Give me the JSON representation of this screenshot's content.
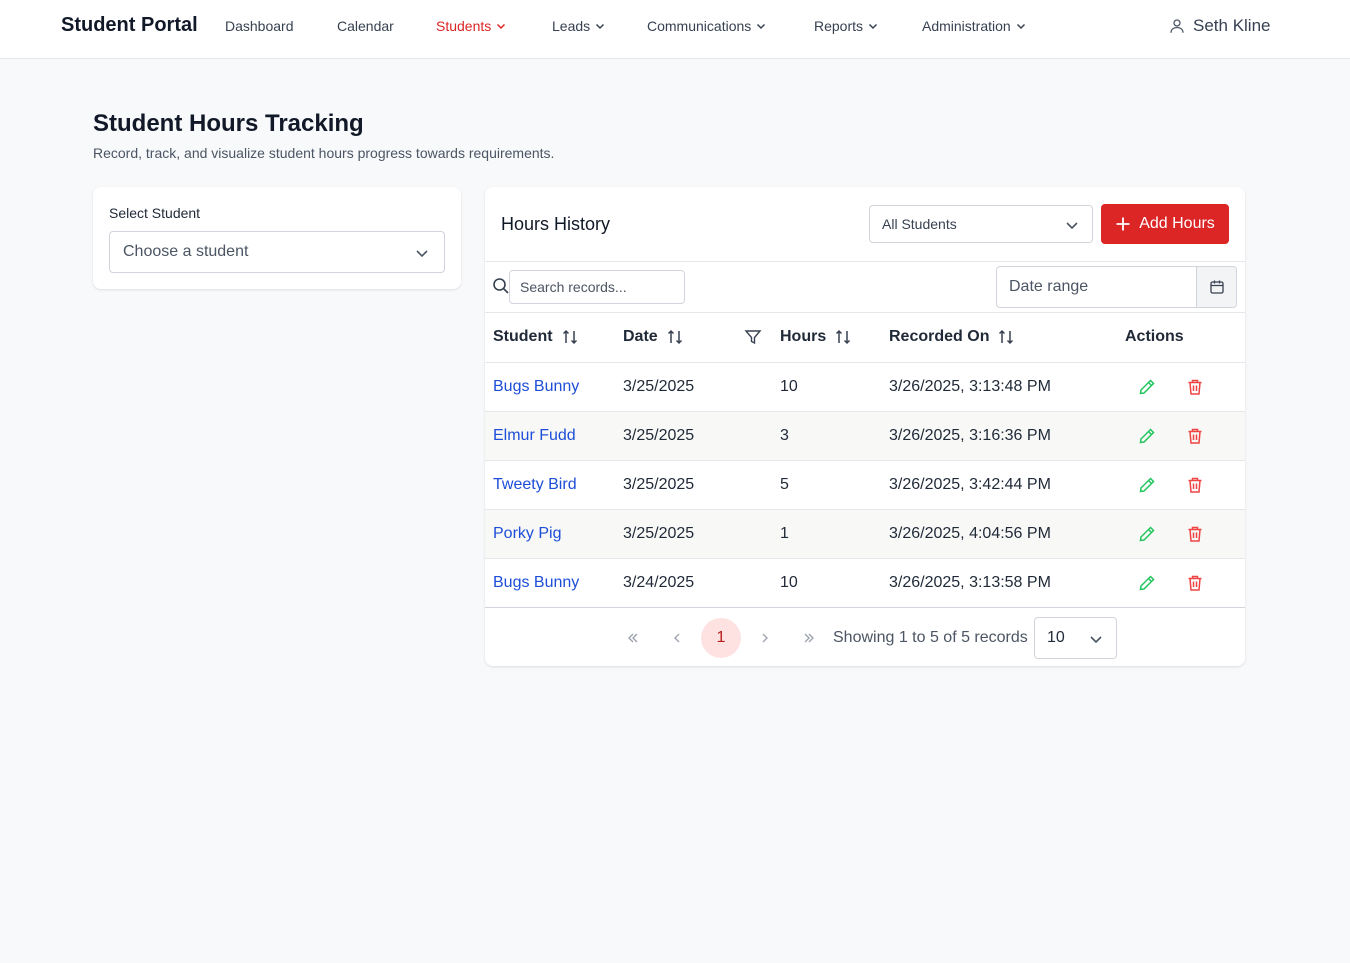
{
  "app": {
    "brand": "Student Portal"
  },
  "nav": {
    "items": [
      {
        "label": "Dashboard",
        "dropdown": false,
        "active": false
      },
      {
        "label": "Calendar",
        "dropdown": false,
        "active": false
      },
      {
        "label": "Students",
        "dropdown": true,
        "active": true
      },
      {
        "label": "Leads",
        "dropdown": true,
        "active": false
      },
      {
        "label": "Communications",
        "dropdown": true,
        "active": false
      },
      {
        "label": "Reports",
        "dropdown": true,
        "active": false
      },
      {
        "label": "Administration",
        "dropdown": true,
        "active": false
      }
    ],
    "user": {
      "name": "Seth Kline",
      "icon": "user-icon"
    }
  },
  "page": {
    "title": "Student Hours Tracking",
    "subtitle": "Record, track, and visualize student hours progress towards requirements."
  },
  "student_select": {
    "label": "Select Student",
    "placeholder": "Choose a student"
  },
  "history": {
    "title": "Hours History",
    "filter_value": "All Students",
    "add_button": "Add Hours",
    "search_placeholder": "Search records...",
    "date_range_placeholder": "Date range",
    "columns": {
      "student": "Student",
      "date": "Date",
      "hours": "Hours",
      "recorded_on": "Recorded On",
      "actions": "Actions"
    },
    "rows": [
      {
        "student": "Bugs Bunny",
        "date": "3/25/2025",
        "hours": "10",
        "recorded_on": "3/26/2025, 3:13:48 PM"
      },
      {
        "student": "Elmur Fudd",
        "date": "3/25/2025",
        "hours": "3",
        "recorded_on": "3/26/2025, 3:16:36 PM"
      },
      {
        "student": "Tweety Bird",
        "date": "3/25/2025",
        "hours": "5",
        "recorded_on": "3/26/2025, 3:42:44 PM"
      },
      {
        "student": "Porky Pig",
        "date": "3/25/2025",
        "hours": "1",
        "recorded_on": "3/26/2025, 4:04:56 PM"
      },
      {
        "student": "Bugs Bunny",
        "date": "3/24/2025",
        "hours": "10",
        "recorded_on": "3/26/2025, 3:13:58 PM"
      }
    ],
    "pagination": {
      "current_page": "1",
      "summary": "Showing 1 to 5 of 5 records",
      "per_page": "10"
    }
  },
  "colors": {
    "accent": "#dc2626",
    "link": "#1d4ed8",
    "edit": "#22c55e",
    "delete": "#ef4444"
  }
}
